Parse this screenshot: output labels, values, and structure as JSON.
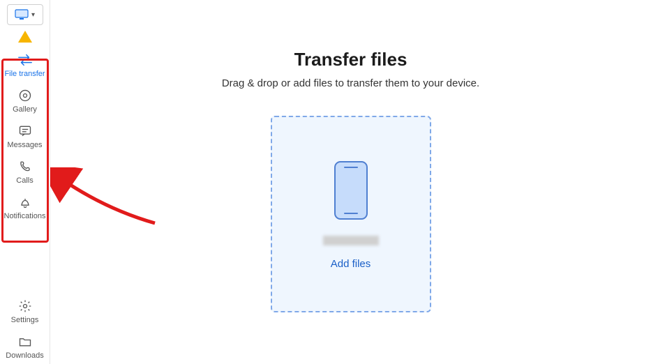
{
  "sidebar": {
    "items": [
      {
        "label": "File transfer",
        "icon": "transfer-icon",
        "active": true
      },
      {
        "label": "Gallery",
        "icon": "gallery-icon"
      },
      {
        "label": "Messages",
        "icon": "messages-icon"
      },
      {
        "label": "Calls",
        "icon": "calls-icon"
      },
      {
        "label": "Notifications",
        "icon": "notifications-icon"
      }
    ],
    "footer": [
      {
        "label": "Settings",
        "icon": "settings-icon"
      },
      {
        "label": "Downloads",
        "icon": "downloads-icon"
      }
    ]
  },
  "main": {
    "title": "Transfer files",
    "subtitle": "Drag & drop or add files to transfer them to your device.",
    "add_files_label": "Add files"
  },
  "colors": {
    "accent": "#1a73e8",
    "highlight": "#e11b1b",
    "dropzone_border": "#7fa8e8",
    "dropzone_bg": "#eff6fe"
  },
  "annotations": {
    "highlight_box": true,
    "arrow": true
  }
}
